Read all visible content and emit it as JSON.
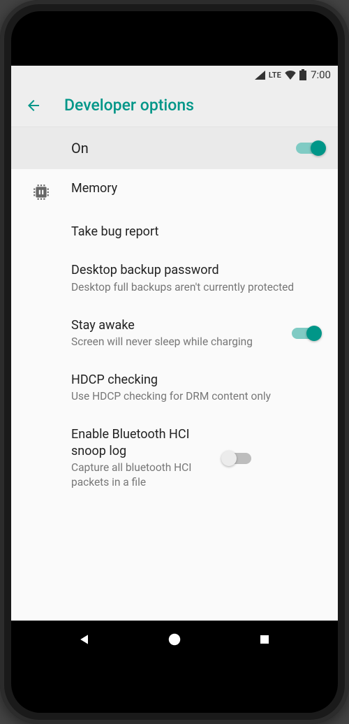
{
  "status": {
    "network": "LTE",
    "time": "7:00"
  },
  "appbar": {
    "title": "Developer options"
  },
  "master": {
    "label": "On",
    "toggle": true
  },
  "items": [
    {
      "icon": "chip",
      "title": "Memory",
      "subtitle": null,
      "toggle": null
    },
    {
      "icon": null,
      "title": "Take bug report",
      "subtitle": null,
      "toggle": null
    },
    {
      "icon": null,
      "title": "Desktop backup password",
      "subtitle": "Desktop full backups aren't currently protected",
      "toggle": null
    },
    {
      "icon": null,
      "title": "Stay awake",
      "subtitle": "Screen will never sleep while charging",
      "toggle": true
    },
    {
      "icon": null,
      "title": "HDCP checking",
      "subtitle": "Use HDCP checking for DRM content only",
      "toggle": null
    },
    {
      "icon": null,
      "title": "Enable Bluetooth HCI snoop log",
      "subtitle": "Capture all bluetooth HCI packets in a file",
      "toggle": false
    }
  ],
  "colors": {
    "accent": "#009688",
    "accent_light": "#80cbc4"
  }
}
